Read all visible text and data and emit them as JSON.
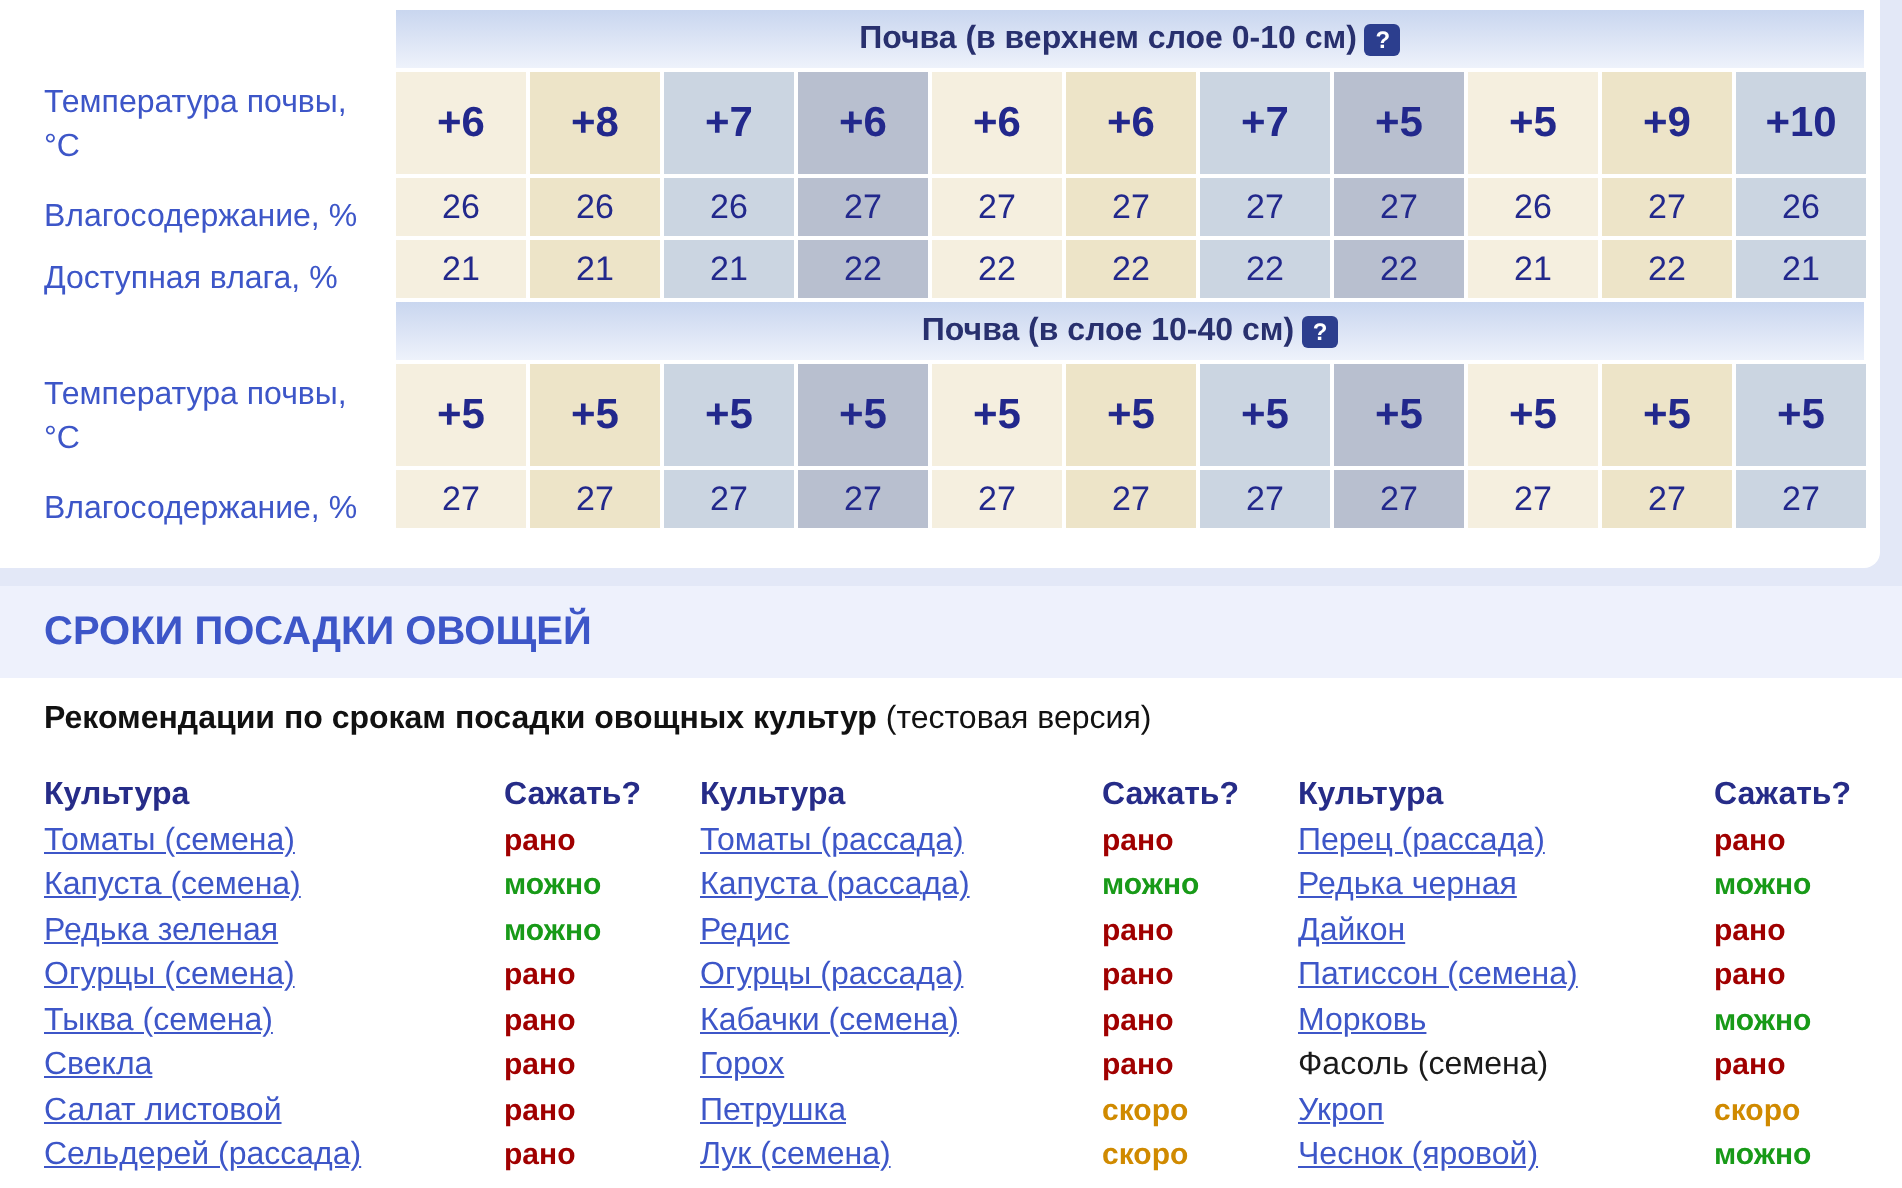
{
  "day_columns": [
    {
      "color": "#f5efdf"
    },
    {
      "color": "#ede4c8"
    },
    {
      "color": "#cbd5e1"
    },
    {
      "color": "#b8bfcf"
    },
    {
      "color": "#f5efdf"
    },
    {
      "color": "#ede4c8"
    },
    {
      "color": "#cbd5e1"
    },
    {
      "color": "#b8bfcf"
    },
    {
      "color": "#f5efdf"
    },
    {
      "color": "#ede4c8"
    },
    {
      "color": "#cbd5e1"
    }
  ],
  "soil_sections": [
    {
      "title": "Почва (в верхнем слое 0-10 см)",
      "help": "?",
      "rows": [
        {
          "kind": "temp",
          "label": "Температура почвы,°C",
          "values": [
            "+6",
            "+8",
            "+7",
            "+6",
            "+6",
            "+6",
            "+7",
            "+5",
            "+5",
            "+9",
            "+10"
          ]
        },
        {
          "kind": "plain",
          "label": "Влагосодержание, %",
          "values": [
            "26",
            "26",
            "26",
            "27",
            "27",
            "27",
            "27",
            "27",
            "26",
            "27",
            "26"
          ]
        },
        {
          "kind": "plain",
          "label": "Доступная влага, %",
          "values": [
            "21",
            "21",
            "21",
            "22",
            "22",
            "22",
            "22",
            "22",
            "21",
            "22",
            "21"
          ]
        }
      ]
    },
    {
      "title": "Почва (в слое 10-40 см)",
      "help": "?",
      "rows": [
        {
          "kind": "temp",
          "label": "Температура почвы,°C",
          "values": [
            "+5",
            "+5",
            "+5",
            "+5",
            "+5",
            "+5",
            "+5",
            "+5",
            "+5",
            "+5",
            "+5"
          ]
        },
        {
          "kind": "plain",
          "label": "Влагосодержание, %",
          "values": [
            "27",
            "27",
            "27",
            "27",
            "27",
            "27",
            "27",
            "27",
            "27",
            "27",
            "27"
          ]
        }
      ]
    }
  ],
  "planting": {
    "title": "СРОКИ ПОСАДКИ ОВОЩЕЙ",
    "intro": "**Рекомендации по срокам посадки овощных культур** (тестовая версия)",
    "columns": [
      {
        "crop_header": "Культура",
        "status_header": "Сажать?",
        "rows": [
          {
            "crop": "Томаты (семена)",
            "link": true,
            "status": "рано",
            "kind": "early"
          },
          {
            "crop": "Капуста (семена)",
            "link": true,
            "status": "можно",
            "kind": "ok"
          },
          {
            "crop": "Редька зеленая",
            "link": true,
            "status": "можно",
            "kind": "ok"
          },
          {
            "crop": "Огурцы (семена)",
            "link": true,
            "status": "рано",
            "kind": "early"
          },
          {
            "crop": "Тыква (семена)",
            "link": true,
            "status": "рано",
            "kind": "early"
          },
          {
            "crop": "Свекла",
            "link": true,
            "status": "рано",
            "kind": "early"
          },
          {
            "crop": "Салат листовой",
            "link": true,
            "status": "рано",
            "kind": "early"
          },
          {
            "crop": "Сельдерей (рассада)",
            "link": true,
            "status": "рано",
            "kind": "early"
          }
        ]
      },
      {
        "crop_header": "Культура",
        "status_header": "Сажать?",
        "rows": [
          {
            "crop": "Томаты (рассада)",
            "link": true,
            "status": "рано",
            "kind": "early"
          },
          {
            "crop": "Капуста (рассада)",
            "link": true,
            "status": "можно",
            "kind": "ok"
          },
          {
            "crop": "Редис",
            "link": true,
            "status": "рано",
            "kind": "early"
          },
          {
            "crop": "Огурцы (рассада)",
            "link": true,
            "status": "рано",
            "kind": "early"
          },
          {
            "crop": "Кабачки (семена)",
            "link": true,
            "status": "рано",
            "kind": "early"
          },
          {
            "crop": "Горох",
            "link": true,
            "status": "рано",
            "kind": "early"
          },
          {
            "crop": "Петрушка",
            "link": true,
            "status": "скоро",
            "kind": "soon"
          },
          {
            "crop": "Лук (семена)",
            "link": true,
            "status": "скоро",
            "kind": "soon"
          }
        ]
      },
      {
        "crop_header": "Культура",
        "status_header": "Сажать?",
        "rows": [
          {
            "crop": "Перец (рассада)",
            "link": true,
            "status": "рано",
            "kind": "early"
          },
          {
            "crop": "Редька черная",
            "link": true,
            "status": "можно",
            "kind": "ok"
          },
          {
            "crop": "Дайкон",
            "link": true,
            "status": "рано",
            "kind": "early"
          },
          {
            "crop": "Патиссон (семена)",
            "link": true,
            "status": "рано",
            "kind": "early"
          },
          {
            "crop": "Морковь",
            "link": true,
            "status": "можно",
            "kind": "ok"
          },
          {
            "crop": "Фасоль (семена)",
            "link": false,
            "status": "рано",
            "kind": "early"
          },
          {
            "crop": "Укроп",
            "link": true,
            "status": "скоро",
            "kind": "soon"
          },
          {
            "crop": "Чеснок (яровой)",
            "link": true,
            "status": "можно",
            "kind": "ok"
          }
        ]
      }
    ]
  }
}
